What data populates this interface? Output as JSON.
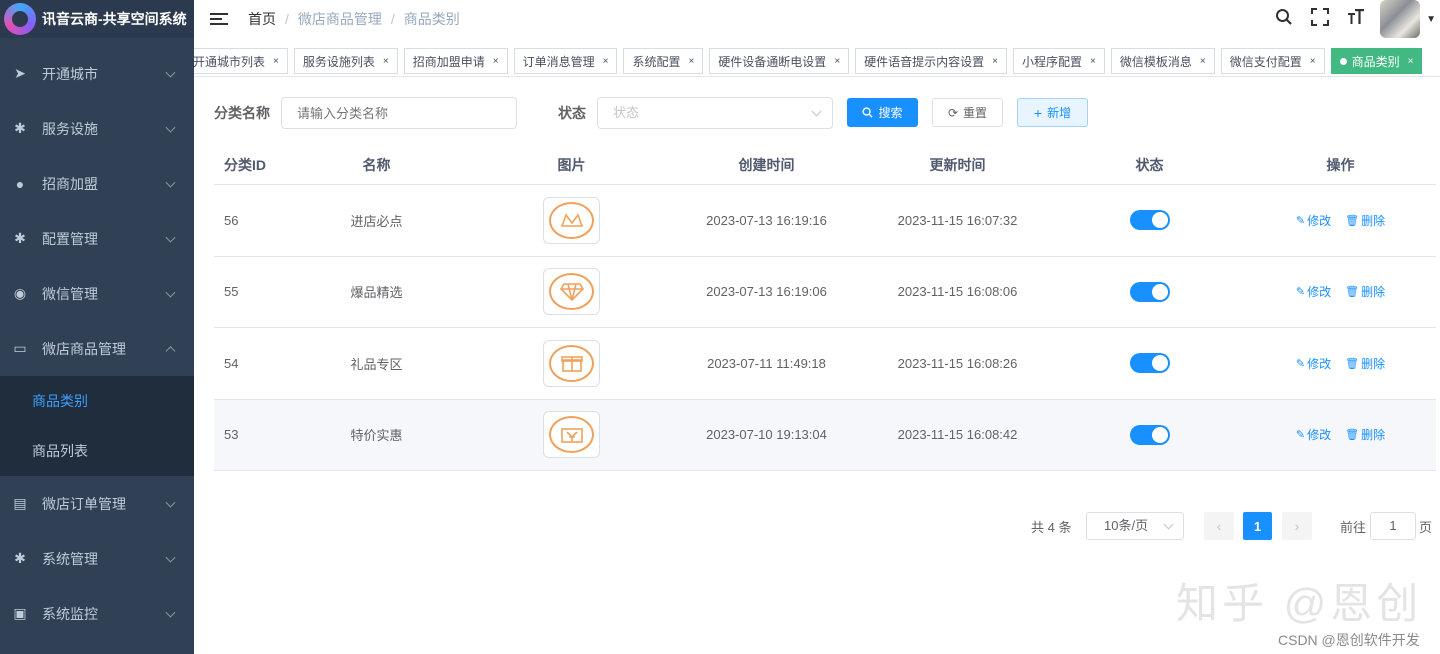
{
  "app": {
    "title": "讯音云商-共享空间系统"
  },
  "sidebar": {
    "items": [
      {
        "label": "开通城市",
        "icon": "send-icon",
        "expanded": false
      },
      {
        "label": "服务设施",
        "icon": "gear-icon",
        "expanded": false
      },
      {
        "label": "招商加盟",
        "icon": "user-icon",
        "expanded": false
      },
      {
        "label": "配置管理",
        "icon": "gear-icon",
        "expanded": false
      },
      {
        "label": "微信管理",
        "icon": "wechat-icon",
        "expanded": false
      },
      {
        "label": "微店商品管理",
        "icon": "shop-icon",
        "expanded": true
      }
    ],
    "submenu": [
      {
        "label": "商品类别",
        "active": true
      },
      {
        "label": "商品列表",
        "active": false
      }
    ],
    "items_after": [
      {
        "label": "微店订单管理",
        "icon": "order-icon"
      },
      {
        "label": "系统管理",
        "icon": "gear-icon"
      },
      {
        "label": "系统监控",
        "icon": "monitor-icon"
      }
    ]
  },
  "breadcrumb": {
    "home": "首页",
    "parent": "微店商品管理",
    "current": "商品类别",
    "separator": "/"
  },
  "tags": [
    "开通城市列表",
    "服务设施列表",
    "招商加盟申请",
    "订单消息管理",
    "系统配置",
    "硬件设备通断电设置",
    "硬件语音提示内容设置",
    "小程序配置",
    "微信模板消息",
    "微信支付配置"
  ],
  "active_tag": "商品类别",
  "tag_close": "×",
  "filter": {
    "name_label": "分类名称",
    "name_placeholder": "请输入分类名称",
    "status_label": "状态",
    "status_placeholder": "状态",
    "search_label": "搜索",
    "reset_label": "重置",
    "add_label": "新增"
  },
  "table": {
    "headers": {
      "id": "分类ID",
      "name": "名称",
      "image": "图片",
      "created": "创建时间",
      "updated": "更新时间",
      "status": "状态",
      "actions": "操作"
    },
    "rows": [
      {
        "id": "56",
        "name": "进店必点",
        "image_icon": "crown-icon",
        "created": "2023-07-13 16:19:16",
        "updated": "2023-11-15 16:07:32",
        "status_on": true
      },
      {
        "id": "55",
        "name": "爆品精选",
        "image_icon": "diamond-icon",
        "created": "2023-07-13 16:19:06",
        "updated": "2023-11-15 16:08:06",
        "status_on": true
      },
      {
        "id": "54",
        "name": "礼品专区",
        "image_icon": "gift-icon",
        "created": "2023-07-11 11:49:18",
        "updated": "2023-11-15 16:08:26",
        "status_on": true
      },
      {
        "id": "53",
        "name": "特价实惠",
        "image_icon": "coupon-icon",
        "created": "2023-07-10 19:13:04",
        "updated": "2023-11-15 16:08:42",
        "status_on": true
      }
    ],
    "edit_label": "修改",
    "delete_label": "删除"
  },
  "pagination": {
    "total_text": "共 4 条",
    "page_size": "10条/页",
    "current_page": "1",
    "goto_label": "前往",
    "goto_value": "1",
    "page_suffix": "页"
  },
  "watermarks": {
    "zhihu": "知乎 @恩创",
    "csdn": "CSDN @恩创软件开发"
  },
  "colors": {
    "sidebar_bg": "#304156",
    "primary": "#1890ff",
    "active_tag": "#42b983",
    "thumb_icon": "#f0a15c"
  }
}
